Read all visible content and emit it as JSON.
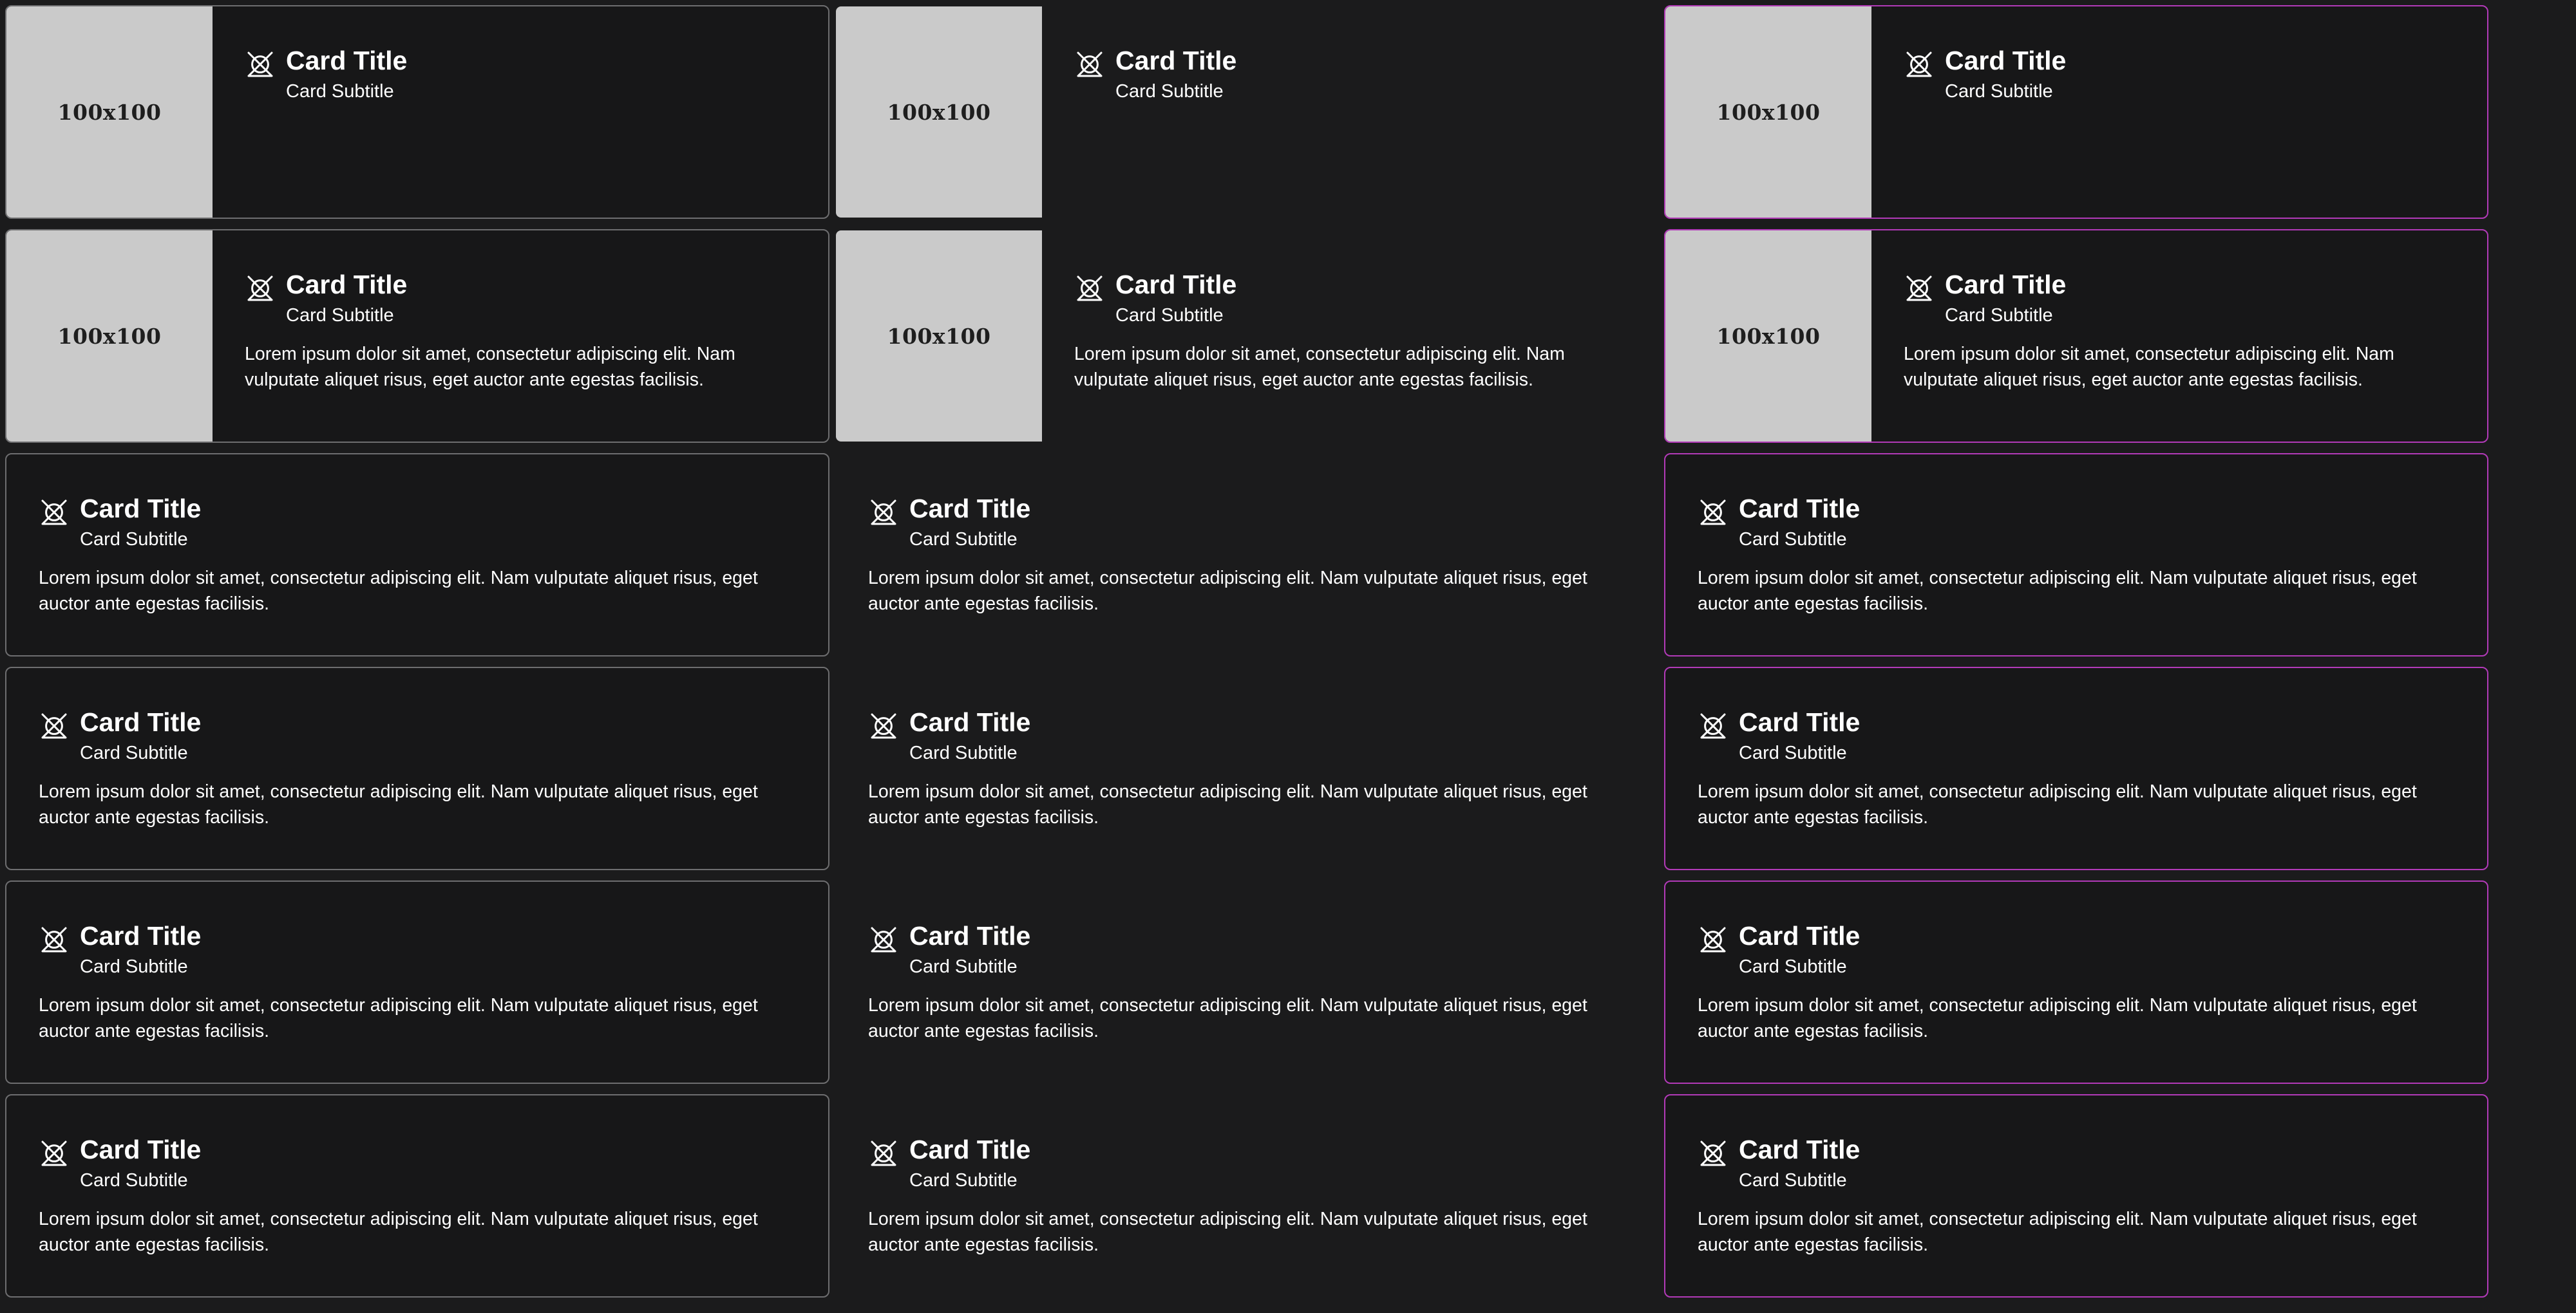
{
  "colors": {
    "page_background": "#1b1b1c",
    "card_background": "#171718",
    "outlined_border": "#6e6e70",
    "accent_border": "#b23ab8",
    "media_placeholder": "#cacaca",
    "text": "#ffffff"
  },
  "card_variants": [
    "outlined",
    "plain",
    "accent"
  ],
  "rows": [
    {
      "layout": "media",
      "cards": [
        {
          "variant": "outlined",
          "media_label": "100x100",
          "icon": "no-image-icon",
          "title": "Card Title",
          "subtitle": "Card Subtitle"
        },
        {
          "variant": "plain",
          "media_label": "100x100",
          "icon": "no-image-icon",
          "title": "Card Title",
          "subtitle": "Card Subtitle"
        },
        {
          "variant": "accent",
          "media_label": "100x100",
          "icon": "no-image-icon",
          "title": "Card Title",
          "subtitle": "Card Subtitle"
        }
      ]
    },
    {
      "layout": "media",
      "cards": [
        {
          "variant": "outlined",
          "media_label": "100x100",
          "icon": "no-image-icon",
          "title": "Card Title",
          "subtitle": "Card Subtitle",
          "text": "Lorem ipsum dolor sit amet, consectetur adipiscing elit. Nam vulputate aliquet risus, eget auctor ante egestas facilisis."
        },
        {
          "variant": "plain",
          "media_label": "100x100",
          "icon": "no-image-icon",
          "title": "Card Title",
          "subtitle": "Card Subtitle",
          "text": "Lorem ipsum dolor sit amet, consectetur adipiscing elit. Nam vulputate aliquet risus, eget auctor ante egestas facilisis."
        },
        {
          "variant": "accent",
          "media_label": "100x100",
          "icon": "no-image-icon",
          "title": "Card Title",
          "subtitle": "Card Subtitle",
          "text": "Lorem ipsum dolor sit amet, consectetur adipiscing elit. Nam vulputate aliquet risus, eget auctor ante egestas facilisis."
        }
      ]
    },
    {
      "layout": "text",
      "cards": [
        {
          "variant": "outlined",
          "icon": "no-image-icon",
          "title": "Card Title",
          "subtitle": "Card Subtitle",
          "text": "Lorem ipsum dolor sit amet, consectetur adipiscing elit. Nam vulputate aliquet risus, eget auctor ante egestas facilisis."
        },
        {
          "variant": "plain",
          "icon": "no-image-icon",
          "title": "Card Title",
          "subtitle": "Card Subtitle",
          "text": "Lorem ipsum dolor sit amet, consectetur adipiscing elit. Nam vulputate aliquet risus, eget auctor ante egestas facilisis."
        },
        {
          "variant": "accent",
          "icon": "no-image-icon",
          "title": "Card Title",
          "subtitle": "Card Subtitle",
          "text": "Lorem ipsum dolor sit amet, consectetur adipiscing elit. Nam vulputate aliquet risus, eget auctor ante egestas facilisis."
        }
      ]
    },
    {
      "layout": "text",
      "cards": [
        {
          "variant": "outlined",
          "icon": "no-image-icon",
          "title": "Card Title",
          "subtitle": "Card Subtitle",
          "text": "Lorem ipsum dolor sit amet, consectetur adipiscing elit. Nam vulputate aliquet risus, eget auctor ante egestas facilisis."
        },
        {
          "variant": "plain",
          "icon": "no-image-icon",
          "title": "Card Title",
          "subtitle": "Card Subtitle",
          "text": "Lorem ipsum dolor sit amet, consectetur adipiscing elit. Nam vulputate aliquet risus, eget auctor ante egestas facilisis."
        },
        {
          "variant": "accent",
          "icon": "no-image-icon",
          "title": "Card Title",
          "subtitle": "Card Subtitle",
          "text": "Lorem ipsum dolor sit amet, consectetur adipiscing elit. Nam vulputate aliquet risus, eget auctor ante egestas facilisis."
        }
      ]
    },
    {
      "layout": "text",
      "cards": [
        {
          "variant": "outlined",
          "icon": "no-image-icon",
          "title": "Card Title",
          "subtitle": "Card Subtitle",
          "text": "Lorem ipsum dolor sit amet, consectetur adipiscing elit. Nam vulputate aliquet risus, eget auctor ante egestas facilisis."
        },
        {
          "variant": "plain",
          "icon": "no-image-icon",
          "title": "Card Title",
          "subtitle": "Card Subtitle",
          "text": "Lorem ipsum dolor sit amet, consectetur adipiscing elit. Nam vulputate aliquet risus, eget auctor ante egestas facilisis."
        },
        {
          "variant": "accent",
          "icon": "no-image-icon",
          "title": "Card Title",
          "subtitle": "Card Subtitle",
          "text": "Lorem ipsum dolor sit amet, consectetur adipiscing elit. Nam vulputate aliquet risus, eget auctor ante egestas facilisis."
        }
      ]
    },
    {
      "layout": "text",
      "cards": [
        {
          "variant": "outlined",
          "icon": "no-image-icon",
          "title": "Card Title",
          "subtitle": "Card Subtitle",
          "text": "Lorem ipsum dolor sit amet, consectetur adipiscing elit. Nam vulputate aliquet risus, eget auctor ante egestas facilisis."
        },
        {
          "variant": "plain",
          "icon": "no-image-icon",
          "title": "Card Title",
          "subtitle": "Card Subtitle",
          "text": "Lorem ipsum dolor sit amet, consectetur adipiscing elit. Nam vulputate aliquet risus, eget auctor ante egestas facilisis."
        },
        {
          "variant": "accent",
          "icon": "no-image-icon",
          "title": "Card Title",
          "subtitle": "Card Subtitle",
          "text": "Lorem ipsum dolor sit amet, consectetur adipiscing elit. Nam vulputate aliquet risus, eget auctor ante egestas facilisis."
        }
      ]
    }
  ]
}
